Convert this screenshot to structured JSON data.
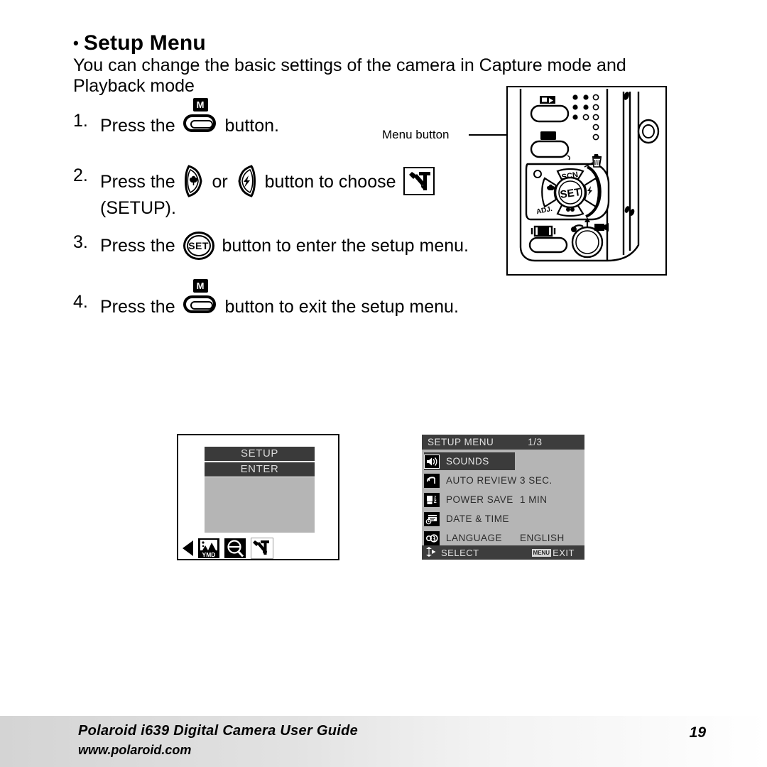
{
  "heading": {
    "bullet": "•",
    "title": "Setup Menu"
  },
  "intro": {
    "line1": "You can change the basic settings of the camera in Capture mode and",
    "line2": "Playback mode"
  },
  "steps": [
    {
      "num": "1.",
      "before": "Press the",
      "icon": "menu-button-glyph",
      "after": "button.",
      "sub": ""
    },
    {
      "num": "2.",
      "before": "Press the",
      "icon": "macro-button-glyph",
      "mid": "or",
      "icon2": "flash-button-glyph",
      "after": "button to choose",
      "icon3": "tools-setup-icon",
      "sub": "(SETUP)."
    },
    {
      "num": "3.",
      "before": "Press the",
      "icon": "set-button-glyph",
      "after": "button to enter the setup menu.",
      "sub": ""
    },
    {
      "num": "4.",
      "before": "Press the",
      "icon": "menu-button-glyph",
      "after": "button to exit the setup menu.",
      "sub": ""
    }
  ],
  "camera_figure": {
    "callout_label": "Menu button",
    "pad_center_label": "SET",
    "pad_top_label": "SCN",
    "pad_bottom_left_label": "ADJ."
  },
  "lcd_preview": {
    "bar_setup": "SETUP",
    "bar_enter": "ENTER",
    "tray_icons": [
      "date-stamp-ymd-icon",
      "zoom-magnifier-icon",
      "tools-setup-icon"
    ],
    "date_stamp_label": "YMD"
  },
  "setup_menu": {
    "title": "SETUP MENU",
    "page": "1/3",
    "rows": [
      {
        "icon": "speaker-icon",
        "label": "SOUNDS",
        "value": "",
        "selected": true
      },
      {
        "icon": "undo-arrow-icon",
        "label": "AUTO REVIEW",
        "value": "3 SEC.",
        "selected": false
      },
      {
        "icon": "power-save-icon",
        "label": "POWER SAVE",
        "value": "1 MIN",
        "selected": false
      },
      {
        "icon": "calendar-icon",
        "label": "DATE & TIME",
        "value": "",
        "selected": false
      },
      {
        "icon": "language-icon",
        "label": "LANGUAGE",
        "value": "ENGLISH",
        "selected": false
      }
    ],
    "footer": {
      "select_label": "SELECT",
      "menu_badge": "MENU",
      "exit_label": "EXIT"
    }
  },
  "footer": {
    "line1": "Polaroid i639 Digital Camera User Guide",
    "line2": "www.polaroid.com",
    "page_number": "19"
  },
  "colors": {
    "menu_bg": "#b5b5b5",
    "menu_header": "#3d3d3d",
    "menu_selected": "#3b3b3b",
    "text_dark": "#2b2b2b"
  }
}
